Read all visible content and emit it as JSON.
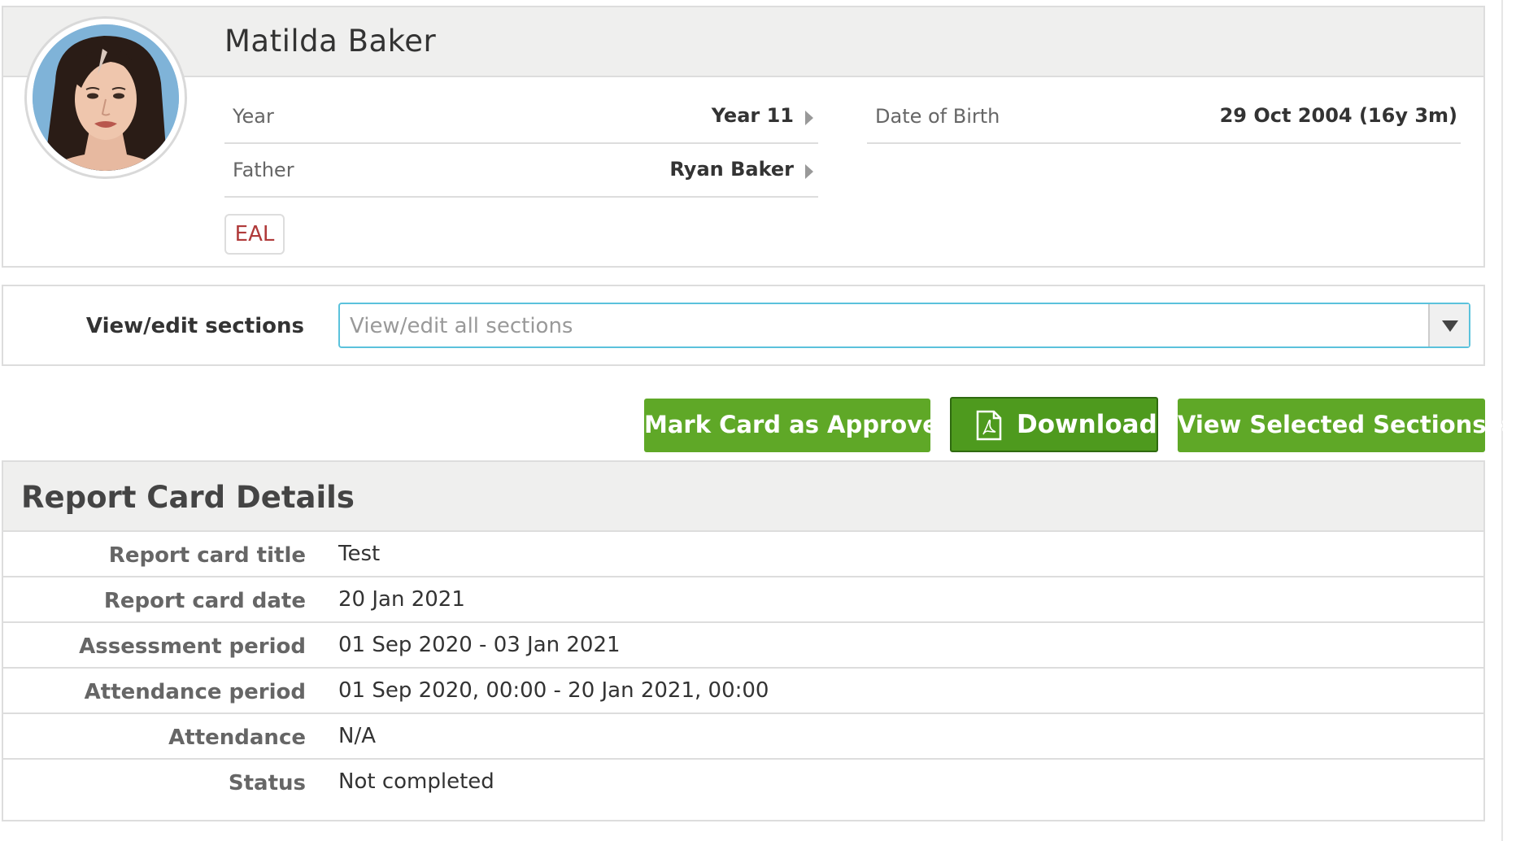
{
  "student": {
    "name": "Matilda Baker",
    "year_label": "Year",
    "year_value": "Year 11",
    "father_label": "Father",
    "father_value": "Ryan Baker",
    "dob_label": "Date of Birth",
    "dob_value": "29 Oct 2004 (16y 3m)",
    "badge": "EAL"
  },
  "sections": {
    "label": "View/edit sections",
    "placeholder": "View/edit all sections"
  },
  "actions": {
    "approve": "Mark Card as Approved",
    "download": "Download",
    "view_selected": "View Selected Sections »"
  },
  "details": {
    "title": "Report Card Details",
    "rows": [
      {
        "label": "Report card title",
        "value": "Test"
      },
      {
        "label": "Report card date",
        "value": "20 Jan 2021"
      },
      {
        "label": "Assessment period",
        "value": "01 Sep 2020 - 03 Jan 2021"
      },
      {
        "label": "Attendance period",
        "value": "01 Sep 2020, 00:00 - 20 Jan 2021, 00:00"
      },
      {
        "label": "Attendance",
        "value": "N/A"
      },
      {
        "label": "Status",
        "value": "Not completed"
      }
    ]
  },
  "colors": {
    "button_green": "#5fa827",
    "download_border": "#2f6a10",
    "badge_text": "#b03a3a",
    "select_border": "#5bc2dc",
    "panel_header": "#efefee"
  },
  "icons": {
    "download": "pdf-file-icon",
    "row_link": "caret-right-icon",
    "select": "triangle-down-icon"
  }
}
